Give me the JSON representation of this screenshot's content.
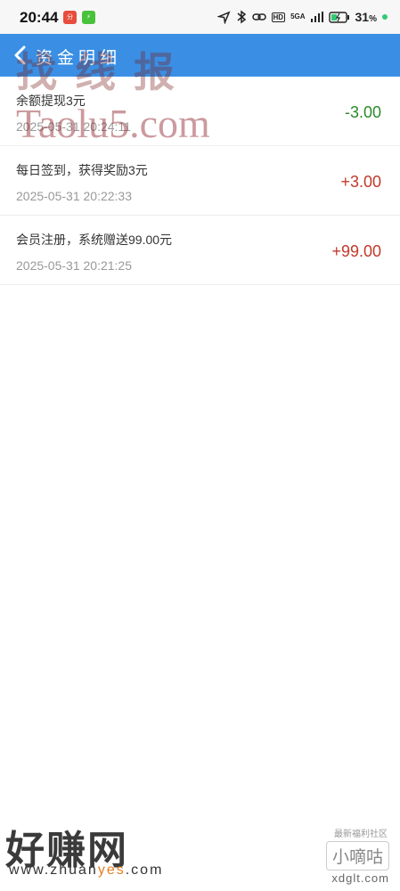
{
  "status_bar": {
    "time": "20:44",
    "app_icon_1": "分",
    "app_icon_2": "⚡",
    "network": "5GA",
    "hd": "HD",
    "battery": "31",
    "battery_unit": "%"
  },
  "header": {
    "title": "资金明细"
  },
  "records": [
    {
      "desc": "余额提现3元",
      "date": "2025-05-31 20:24:11",
      "amount": "-3.00",
      "sign": "neg"
    },
    {
      "desc": "每日签到，获得奖励3元",
      "date": "2025-05-31 20:22:33",
      "amount": "+3.00",
      "sign": "pos"
    },
    {
      "desc": "会员注册，系统赠送99.00元",
      "date": "2025-05-31 20:21:25",
      "amount": "+99.00",
      "sign": "pos"
    }
  ],
  "watermarks": {
    "top_cn": "找 线 报",
    "top_url": "Taolu5.com",
    "bottom_cn": "好赚网",
    "bottom_url_a": "www.zhuan",
    "bottom_url_b": "yes",
    "bottom_url_c": ".com",
    "right_small": "最新福利社区",
    "right_box": "小嘀咕",
    "right_url": "xdglt.com"
  },
  "colors": {
    "header_bg": "#3a8fe4",
    "negative": "#2a8a2a",
    "positive": "#c0392b"
  }
}
